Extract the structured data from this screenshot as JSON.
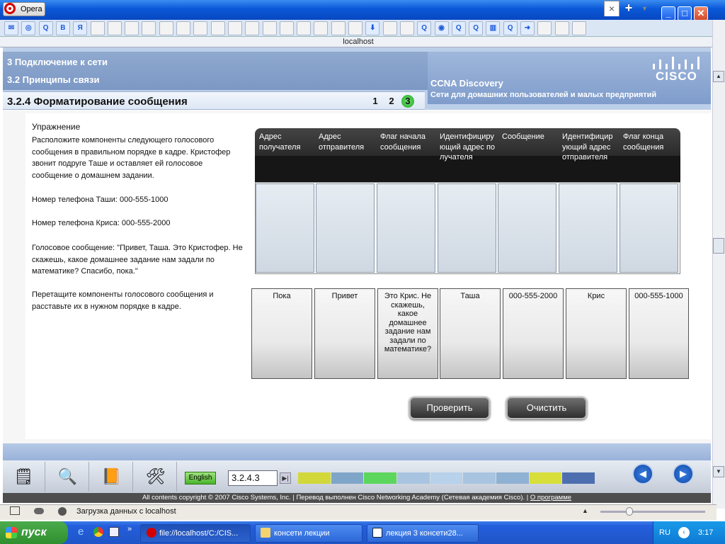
{
  "browser": {
    "app_name": "Opera",
    "address": "localhost",
    "status": "Загрузка данных с localhost",
    "tabs": [
      "✉",
      "◎",
      "Q",
      "B",
      "Я",
      "",
      "",
      "",
      "",
      "",
      "",
      "",
      "",
      "",
      "",
      "",
      "",
      "",
      "",
      "",
      "",
      "⬇",
      "",
      "",
      "Q",
      "◉",
      "Q",
      "Q",
      "▥",
      "Q",
      "➜",
      "",
      "",
      ""
    ]
  },
  "header": {
    "section1": "3 Подключение к сети",
    "section2": "3.2 Принципы связи",
    "page_title": "3.2.4 Форматирование сообщения",
    "pages": [
      "1",
      "2",
      "3"
    ],
    "course": "CCNA Discovery",
    "course_sub": "Сети для домашних пользователей и малых предприятий",
    "logo_text": "CISCO"
  },
  "exercise": {
    "title": "Упражнение",
    "intro": "Расположите компоненты следующего голосового сообщения в правильном порядке в кадре. Кристофер звонит подруге Таше и оставляет ей голосовое сообщение о домашнем задании.",
    "phone_tasha": "Номер телефона Таши: 000-555-1000",
    "phone_chris": "Номер телефона Криса: 000-555-2000",
    "voice_msg": "Голосовое сообщение:  \"Привет, Таша. Это Кристофер. Не скажешь, какое домашнее задание нам задали по математике? Спасибо, пока.\"",
    "instruction": "Перетащите компоненты голосового сообщения и расставьте их в нужном порядке в кадре."
  },
  "frame": {
    "columns": [
      "Адрес получателя",
      "Адрес отправителя",
      "Флаг начала сообщения",
      "Идентифицирующий адрес получателя",
      "Сообщение",
      "Идентифицирующий адрес отправителя",
      "Флаг конца сообщения"
    ]
  },
  "cards": [
    "Пока",
    "Привет",
    "Это Крис. Не скажешь, какое домашнее задание нам задали по математике?",
    "Таша",
    "000-555-2000",
    "Крис",
    "000-555-1000"
  ],
  "buttons": {
    "check": "Проверить",
    "clear": "Очистить"
  },
  "toolbar": {
    "language": "English",
    "page_field": "3.2.4.3",
    "progress_colors": [
      "#d2d83a",
      "#7fa6c8",
      "#5cd65c",
      "#a8c4e0",
      "#b7d2ea",
      "#a8c4e0",
      "#8fb1d3",
      "#d8df3a",
      "#4d6fb0"
    ]
  },
  "copyright": {
    "text": "All contents copyright © 2007 Cisco Systems, Inc. | Перевод выполнен Cisco Networking Academy (Сетевая академия Cisco). | ",
    "link": "О программе"
  },
  "taskbar": {
    "start": "пуск",
    "tasks": [
      "file://localhost/C:/CIS...",
      "консети лекции",
      "лекция 3 консети28..."
    ],
    "lang": "RU",
    "clock": "3:17"
  }
}
